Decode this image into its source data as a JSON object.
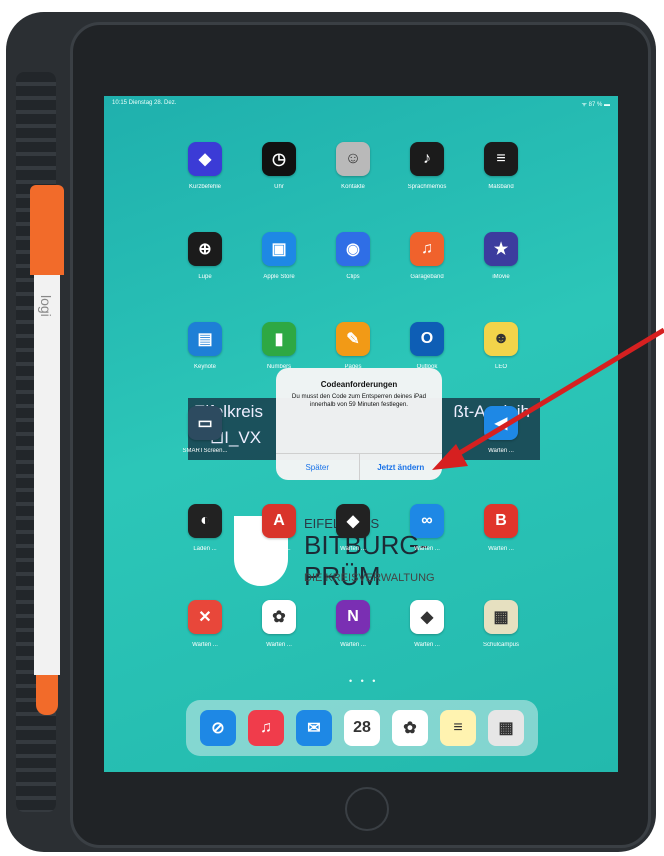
{
  "status": {
    "time": "10:15  Dienstag 28. Dez.",
    "battery": "ᯤ 87 % ▬"
  },
  "apps": [
    {
      "label": "Kurzbefehle",
      "color": "#3b3bd6",
      "glyph": "◆"
    },
    {
      "label": "Uhr",
      "color": "#111111",
      "glyph": "◷"
    },
    {
      "label": "Kontakte",
      "color": "#b9b9b9",
      "glyph": "☺"
    },
    {
      "label": "Sprachmemos",
      "color": "#1b1b1b",
      "glyph": "♪"
    },
    {
      "label": "Maßband",
      "color": "#1b1b1b",
      "glyph": "≡"
    },
    {
      "label": "Lupe",
      "color": "#1b1b1b",
      "glyph": "⊕"
    },
    {
      "label": "Apple Store",
      "color": "#1e88e5",
      "glyph": "▣"
    },
    {
      "label": "Clips",
      "color": "#2f6ee6",
      "glyph": "◉"
    },
    {
      "label": "Garageband",
      "color": "#f0622c",
      "glyph": "♫"
    },
    {
      "label": "iMovie",
      "color": "#3c3c9e",
      "glyph": "★"
    },
    {
      "label": "Keynote",
      "color": "#1e7fd6",
      "glyph": "▤"
    },
    {
      "label": "Numbers",
      "color": "#2ea843",
      "glyph": "▮"
    },
    {
      "label": "Pages",
      "color": "#f29a16",
      "glyph": "✎"
    },
    {
      "label": "Outlook",
      "color": "#0e5eb5",
      "glyph": "O"
    },
    {
      "label": "LEO",
      "color": "#f2d44a",
      "glyph": "☻"
    },
    {
      "label": "SMARTScreen...",
      "color": "#2d4b60",
      "glyph": "▭"
    },
    {
      "label": "Warten ...",
      "color": "#1e88e5",
      "glyph": "◀"
    },
    {
      "label": "Laden ...",
      "color": "#222222",
      "glyph": "◐"
    },
    {
      "label": "Laden ...",
      "color": "#d9342b",
      "glyph": "A"
    },
    {
      "label": "Warten ...",
      "color": "#222222",
      "glyph": "◆"
    },
    {
      "label": "Warten ...",
      "color": "#1e88e5",
      "glyph": "∞"
    },
    {
      "label": "Warten ...",
      "color": "#e0352b",
      "glyph": "B"
    },
    {
      "label": "Warten ...",
      "color": "#e8473a",
      "glyph": "✕"
    },
    {
      "label": "Warten ...",
      "color": "#ffffff",
      "glyph": "✿"
    },
    {
      "label": "Warten ...",
      "color": "#7a2fb3",
      "glyph": "N"
    },
    {
      "label": "Warten ...",
      "color": "#ffffff",
      "glyph": "◆"
    },
    {
      "label": "Schulcampus",
      "color": "#e6e0c0",
      "glyph": "▦"
    }
  ],
  "banner": {
    "left": "Eifelkreis",
    "right": "ßt-Ausleih",
    "sub": "⊡I_VX"
  },
  "logo": {
    "line1": "EIFELKREIS",
    "line2": "BITBURG-PRÜM",
    "line3": "DIE KREISVERWALTUNG"
  },
  "dialog": {
    "title": "Codeanforderungen",
    "message": "Du musst den Code zum Entsperren deines iPad innerhalb von 59 Minuten festlegen.",
    "later": "Später",
    "change_now": "Jetzt ändern"
  },
  "page_dots": "• • •",
  "dock": [
    {
      "name": "safari",
      "color": "#1e88e5",
      "glyph": "⊘"
    },
    {
      "name": "music",
      "color": "#f03c4b",
      "glyph": "♫"
    },
    {
      "name": "mail",
      "color": "#1e88e5",
      "glyph": "✉"
    },
    {
      "name": "calendar",
      "color": "#ffffff",
      "glyph": "28",
      "day": "DI"
    },
    {
      "name": "photos",
      "color": "#ffffff",
      "glyph": "✿"
    },
    {
      "name": "notes",
      "color": "#fff3b0",
      "glyph": "≡"
    },
    {
      "name": "folder",
      "color": "#e6e6e6",
      "glyph": "▦"
    }
  ],
  "pencil": {
    "brand": "logi"
  },
  "annotation_color": "#d62020"
}
